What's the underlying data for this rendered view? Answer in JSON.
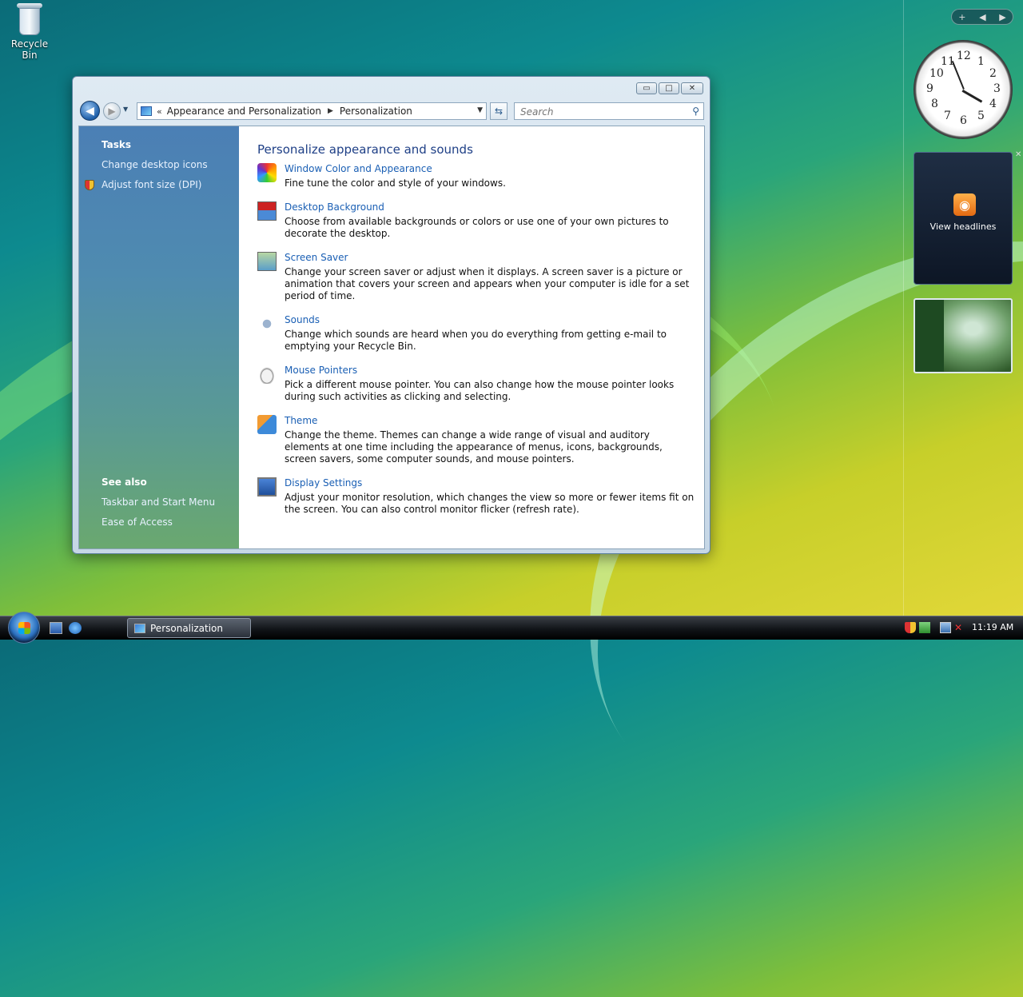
{
  "desktop": {
    "recycle_bin_label": "Recycle Bin"
  },
  "window": {
    "controls": {
      "minimize": "▭",
      "maximize": "□",
      "close": "✕"
    },
    "address": {
      "chevron": "«",
      "crumbs": [
        "Appearance and Personalization",
        "Personalization"
      ]
    },
    "search": {
      "placeholder": "Search"
    },
    "left_pane": {
      "tasks_heading": "Tasks",
      "tasks": [
        "Change desktop icons",
        "Adjust font size (DPI)"
      ],
      "see_also_heading": "See also",
      "see_also": [
        "Taskbar and Start Menu",
        "Ease of Access"
      ]
    },
    "main": {
      "title": "Personalize appearance and sounds",
      "items": [
        {
          "link": "Window Color and Appearance",
          "desc": "Fine tune the color and style of your windows."
        },
        {
          "link": "Desktop Background",
          "desc": "Choose from available backgrounds or colors or use one of your own pictures to decorate the desktop."
        },
        {
          "link": "Screen Saver",
          "desc": "Change your screen saver or adjust when it displays. A screen saver is a picture or animation that covers your screen and appears when your computer is idle for a set period of time."
        },
        {
          "link": "Sounds",
          "desc": "Change which sounds are heard when you do everything from getting e-mail to emptying your Recycle Bin."
        },
        {
          "link": "Mouse Pointers",
          "desc": "Pick a different mouse pointer. You can also change how the mouse pointer looks during such activities as clicking and selecting."
        },
        {
          "link": "Theme",
          "desc": "Change the theme. Themes can change a wide range of visual and auditory elements at one time including the appearance of menus, icons, backgrounds, screen savers, some computer sounds, and mouse pointers."
        },
        {
          "link": "Display Settings",
          "desc": "Adjust your monitor resolution, which changes the view so more or fewer items fit on the screen. You can also control monitor flicker (refresh rate)."
        }
      ]
    }
  },
  "gadgets": {
    "add_symbol": "+",
    "clock_numbers": [
      "12",
      "1",
      "2",
      "3",
      "4",
      "5",
      "6",
      "7",
      "8",
      "9",
      "10",
      "11"
    ],
    "feed_label": "View headlines"
  },
  "taskbar": {
    "task_button_label": "Personalization",
    "time": "11:19 AM"
  }
}
